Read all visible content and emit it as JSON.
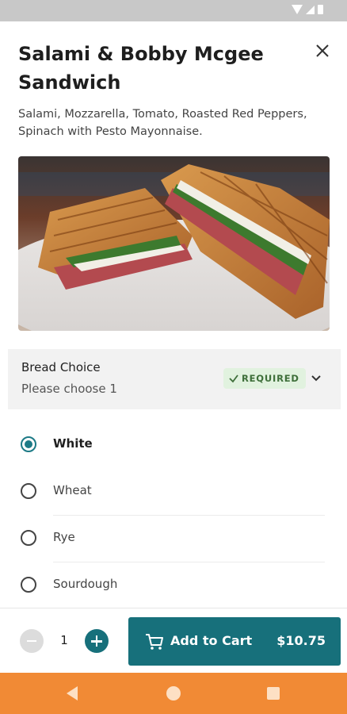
{
  "item": {
    "title": "Salami & Bobby Mcgee Sandwich",
    "description": "Salami, Mozzarella, Tomato, Roasted Red Peppers, Spinach with Pesto Mayonnaise."
  },
  "bread_choice": {
    "title": "Bread Choice",
    "subtitle": "Please choose 1",
    "badge": "REQUIRED",
    "options": [
      {
        "label": "White",
        "selected": true
      },
      {
        "label": "Wheat",
        "selected": false
      },
      {
        "label": "Rye",
        "selected": false
      },
      {
        "label": "Sourdough",
        "selected": false
      }
    ]
  },
  "cart": {
    "quantity": "1",
    "add_label": "Add to Cart",
    "price": "$10.75"
  },
  "colors": {
    "accent": "#17707b",
    "nav_bar": "#f18a35",
    "required_bg": "#e1f2df",
    "status_bar": "#c8c8c8"
  },
  "icons": {
    "close": "close-icon",
    "chevron": "chevron-down-icon",
    "check": "check-icon",
    "cart": "cart-icon",
    "nav": [
      "back-icon",
      "home-icon",
      "recents-icon"
    ]
  }
}
